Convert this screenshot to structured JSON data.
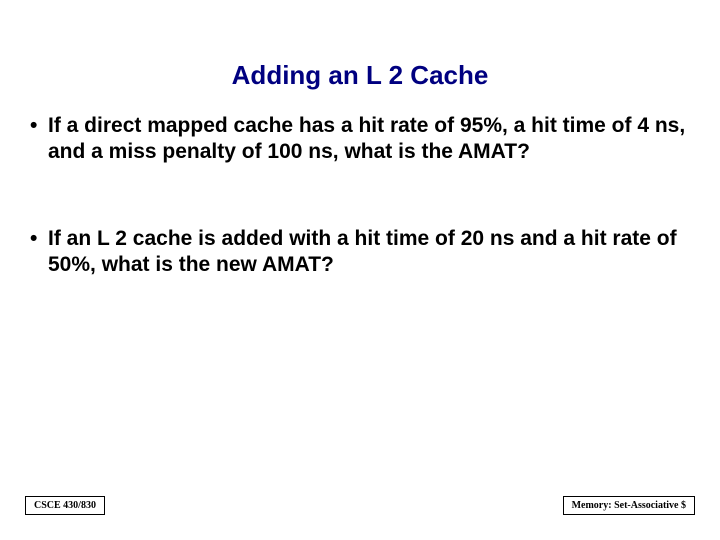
{
  "title": "Adding an L 2 Cache",
  "bullets": [
    "If a direct mapped cache has a hit rate of 95%, a hit time of 4 ns, and a miss penalty of 100 ns, what is the AMAT?",
    "If an L 2 cache is added with a hit time of 20 ns and a hit rate of 50%, what is the new AMAT?"
  ],
  "footer": {
    "left": "CSCE 430/830",
    "right": "Memory: Set-Associative $"
  }
}
